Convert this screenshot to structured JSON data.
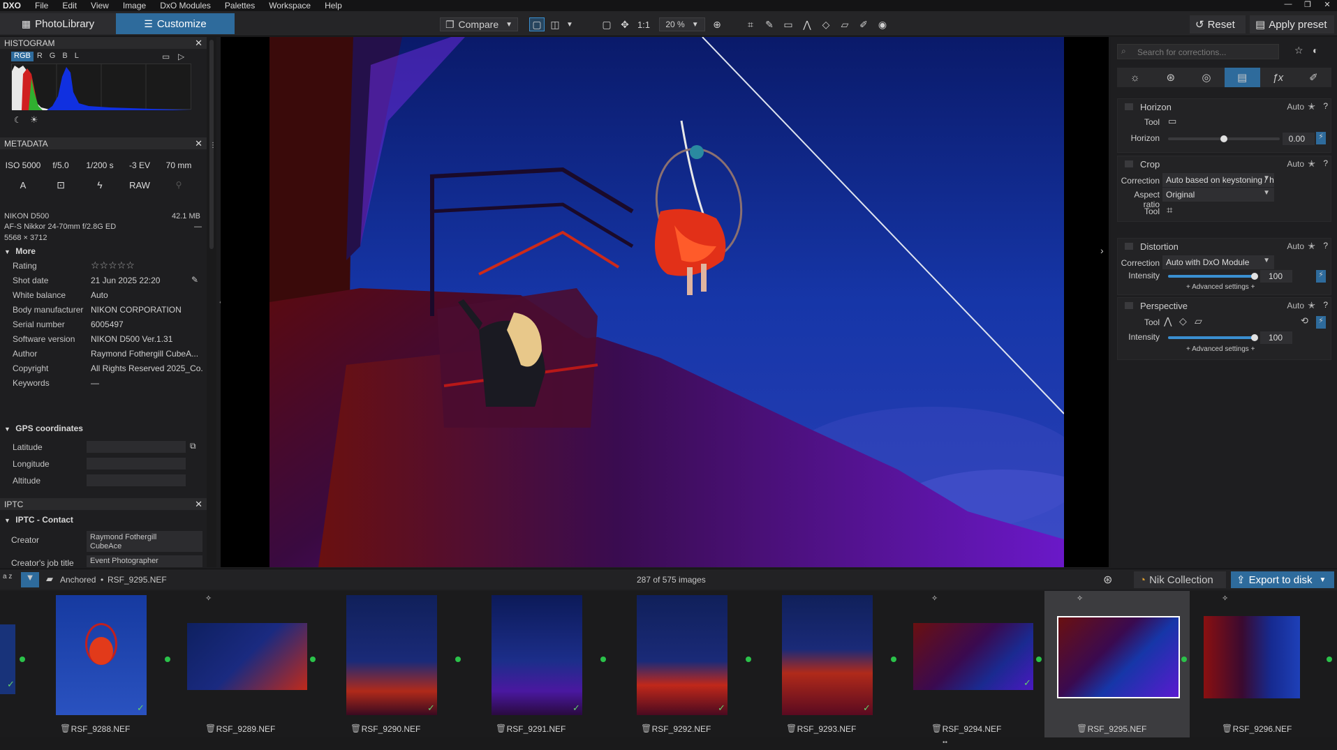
{
  "menubar": {
    "logo": "DXO",
    "items": [
      "File",
      "Edit",
      "View",
      "Image",
      "DxO Modules",
      "Palettes",
      "Workspace",
      "Help"
    ]
  },
  "toolbar": {
    "tab_photolibrary": "PhotoLibrary",
    "tab_customize": "Customize",
    "compare": "Compare",
    "one_to_one": "1:1",
    "zoom": "20 %",
    "reset": "Reset",
    "apply_preset": "Apply preset"
  },
  "histogram": {
    "title": "HISTOGRAM",
    "channels": [
      "RGB",
      "R",
      "G",
      "B",
      "L"
    ]
  },
  "metadata": {
    "title": "METADATA",
    "exif": [
      "ISO 5000",
      "f/5.0",
      "1/200 s",
      "-3 EV",
      "70 mm"
    ],
    "mode_a": "A",
    "raw": "RAW",
    "camera": "NIKON D500",
    "filesize": "42.1 MB",
    "lens": "AF-S Nikkor 24-70mm f/2.8G ED",
    "lens_dash": "—",
    "dimensions": "5568 × 3712",
    "more_label": "More",
    "fields": [
      {
        "k": "Rating",
        "v": "☆☆☆☆☆"
      },
      {
        "k": "Shot date",
        "v": "21 Jun 2025 22:20"
      },
      {
        "k": "White balance",
        "v": "Auto"
      },
      {
        "k": "Body manufacturer",
        "v": "NIKON CORPORATION"
      },
      {
        "k": "Serial number",
        "v": "6005497"
      },
      {
        "k": "Software version",
        "v": "NIKON D500 Ver.1.31"
      },
      {
        "k": "Author",
        "v": "Raymond Fothergill  CubeA..."
      },
      {
        "k": "Copyright",
        "v": "All Rights Reserved 2025_Co..."
      },
      {
        "k": "Keywords",
        "v": "—"
      }
    ],
    "gps_label": "GPS coordinates",
    "gps": [
      "Latitude",
      "Longitude",
      "Altitude"
    ]
  },
  "iptc": {
    "title": "IPTC",
    "contact_label": "IPTC - Contact",
    "creator_label": "Creator",
    "creator_value_1": "Raymond Fothergill",
    "creator_value_2": "CubeAce",
    "job_label": "Creator's job title",
    "job_value": "Event Photographer"
  },
  "right": {
    "search_placeholder": "Search for corrections...",
    "horizon": {
      "title": "Horizon",
      "auto": "Auto",
      "tool": "Tool",
      "label": "Horizon",
      "value": "0.00",
      "level": 0.5
    },
    "crop": {
      "title": "Crop",
      "auto": "Auto",
      "correction_label": "Correction",
      "correction": "Auto based on keystoning / h...",
      "aspect_label": "Aspect ratio",
      "aspect": "Original",
      "tool": "Tool"
    },
    "distortion": {
      "title": "Distortion",
      "auto": "Auto",
      "correction_label": "Correction",
      "correction": "Auto with DxO Module",
      "intensity_label": "Intensity",
      "intensity": "100",
      "advanced": "+ Advanced settings +"
    },
    "perspective": {
      "title": "Perspective",
      "auto": "Auto",
      "tool": "Tool",
      "intensity_label": "Intensity",
      "intensity": "100",
      "advanced": "+ Advanced settings +"
    }
  },
  "stripbar": {
    "sort": "a z",
    "folder": "Anchored",
    "file": "RSF_9295.NEF",
    "count": "287 of 575 images",
    "nik": "Nik Collection",
    "export": "Export to disk"
  },
  "thumbs": [
    "RSF_9288.NEF",
    "RSF_9289.NEF",
    "RSF_9290.NEF",
    "RSF_9291.NEF",
    "RSF_9292.NEF",
    "RSF_9293.NEF",
    "RSF_9294.NEF",
    "RSF_9295.NEF",
    "RSF_9296.NEF"
  ],
  "colors": {
    "accent": "#2e6b9c",
    "selected_thumb": "#3c3c3f",
    "status_dot": "#2bc24a"
  }
}
